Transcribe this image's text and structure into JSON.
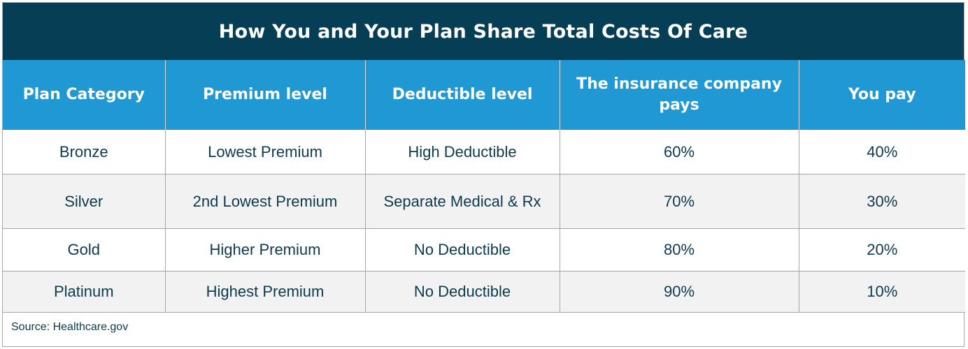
{
  "title": "How You and Your Plan Share Total Costs Of Care",
  "columns": [
    "Plan Category",
    "Premium level",
    "Deductible level",
    "The insurance company pays",
    "You pay"
  ],
  "rows": [
    [
      "Bronze",
      "Lowest Premium",
      "High Deductible",
      "60%",
      "40%"
    ],
    [
      "Silver",
      "2nd Lowest Premium",
      "Separate Medical & Rx",
      "70%",
      "30%"
    ],
    [
      "Gold",
      "Higher Premium",
      "No Deductible",
      "80%",
      "20%"
    ],
    [
      "Platinum",
      "Highest Premium",
      "No Deductible",
      "90%",
      "10%"
    ]
  ],
  "source": "Source: Healthcare.gov",
  "colors": {
    "title_bg": "#063f55",
    "header_bg": "#1f98d4",
    "row_alt_bg": "#f2f2f2",
    "text": "#0d3a4f"
  }
}
